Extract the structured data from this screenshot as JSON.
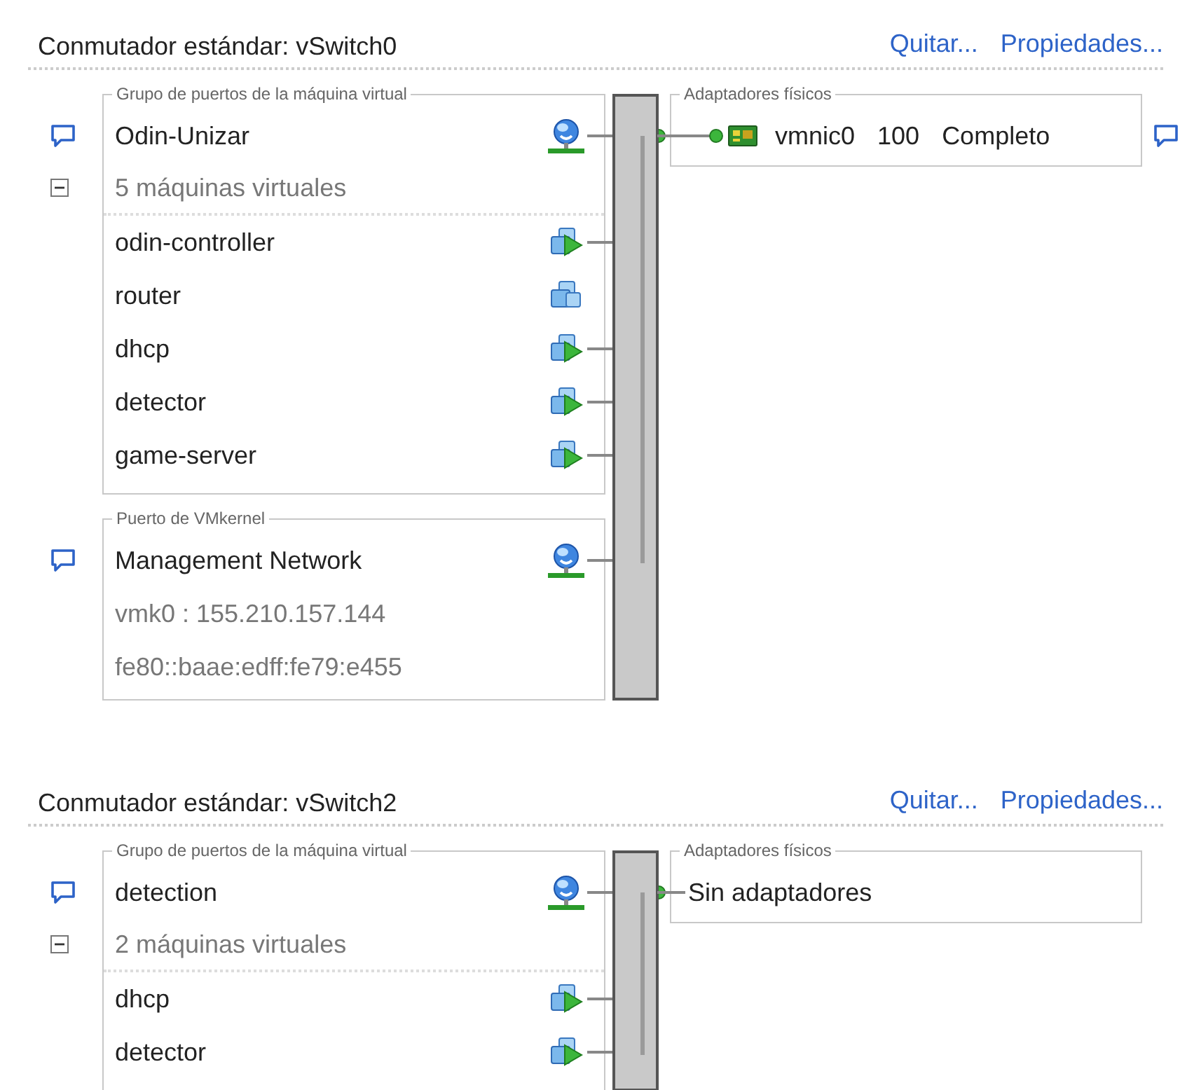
{
  "switches": [
    {
      "title": "Conmutador estándar: vSwitch0",
      "actions": [
        "Quitar...",
        "Propiedades..."
      ],
      "port_groups": [
        {
          "kind": "vm",
          "legend": "Grupo de puertos de la máquina virtual",
          "name": "Odin-Unizar",
          "vm_count": "5 máquinas virtuales",
          "expanded": true,
          "vms": [
            {
              "name": "odin-controller",
              "powered_on": true
            },
            {
              "name": "router",
              "powered_on": false
            },
            {
              "name": "dhcp",
              "powered_on": true
            },
            {
              "name": "detector",
              "powered_on": true
            },
            {
              "name": "game-server",
              "powered_on": true
            }
          ]
        },
        {
          "kind": "vmkernel",
          "legend": "Puerto de VMkernel",
          "name": "Management Network",
          "addresses": [
            "vmk0 : 155.210.157.144",
            "fe80::baae:edff:fe79:e455"
          ]
        }
      ],
      "adapters": {
        "legend": "Adaptadores físicos",
        "items": [
          {
            "name": "vmnic0",
            "speed": "100",
            "duplex": "Completo"
          }
        ]
      }
    },
    {
      "title": "Conmutador estándar: vSwitch2",
      "actions": [
        "Quitar...",
        "Propiedades..."
      ],
      "port_groups": [
        {
          "kind": "vm",
          "legend": "Grupo de puertos de la máquina virtual",
          "name": "detection",
          "vm_count": "2 máquinas virtuales",
          "expanded": true,
          "vms": [
            {
              "name": "dhcp",
              "powered_on": true
            },
            {
              "name": "detector",
              "powered_on": true
            }
          ]
        }
      ],
      "adapters": {
        "legend": "Adaptadores físicos",
        "empty_text": "Sin adaptadores"
      }
    }
  ]
}
